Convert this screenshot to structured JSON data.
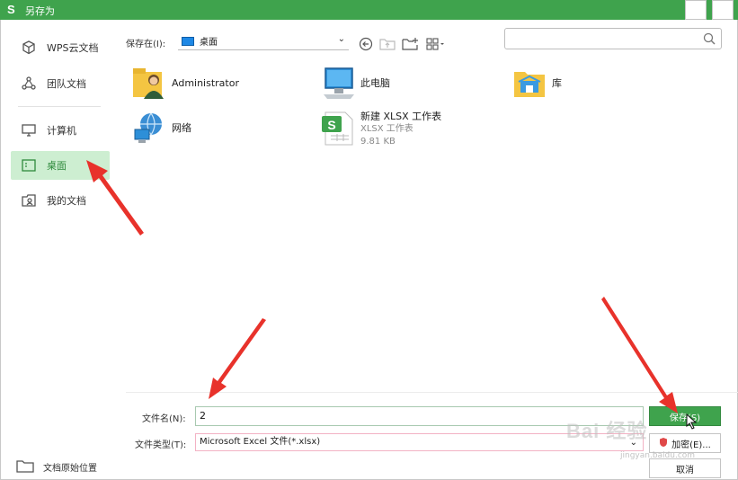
{
  "window": {
    "logo": "S",
    "title": "另存为",
    "maximize_icon": "◻",
    "close_icon": "✕"
  },
  "sidebar": {
    "items": [
      {
        "label": "WPS云文档",
        "icon": "cube-icon"
      },
      {
        "label": "团队文档",
        "icon": "team-icon"
      },
      {
        "label": "计算机",
        "icon": "monitor-icon"
      },
      {
        "label": "桌面",
        "icon": "desktop-icon",
        "active": true
      },
      {
        "label": "我的文档",
        "icon": "my-docs-icon"
      }
    ],
    "origin_label": "文档原始位置"
  },
  "location_bar": {
    "label": "保存在(I):",
    "value": "桌面"
  },
  "files": [
    {
      "name": "Administrator",
      "icon": "user-folder-icon"
    },
    {
      "name": "此电脑",
      "icon": "computer-icon"
    },
    {
      "name": "库",
      "icon": "library-folder-icon"
    },
    {
      "name": "网络",
      "icon": "network-icon"
    },
    {
      "name": "新建 XLSX 工作表",
      "type": "XLSX 工作表",
      "size": "9.81 KB",
      "icon": "xlsx-file-icon"
    }
  ],
  "form": {
    "filename_label": "文件名(N):",
    "filename_value": "2",
    "filetype_label": "文件类型(T):",
    "filetype_value": "Microsoft Excel 文件(*.xlsx)"
  },
  "buttons": {
    "save": "保存(S)",
    "encrypt": "加密(E)...",
    "cancel": "取消"
  },
  "watermark": {
    "text": "Bai 经验",
    "sub": "jingyan.baidu.com"
  },
  "colors": {
    "accent": "#3fa34d",
    "active_bg": "#cdeed1",
    "annotation": "#e8322b"
  }
}
